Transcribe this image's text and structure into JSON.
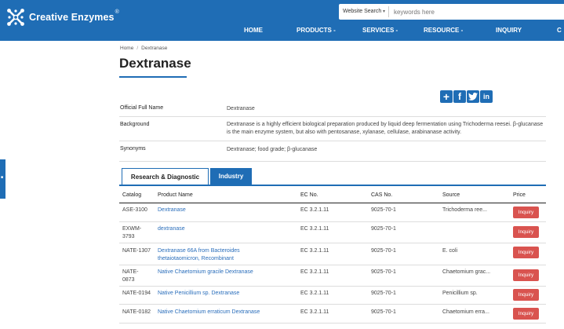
{
  "header": {
    "brand": "Creative Enzymes",
    "brand_mark": "®",
    "search_scope": "Website Search",
    "search_placeholder": "keywords here",
    "nav": [
      {
        "label": "HOME"
      },
      {
        "label": "PRODUCTS -"
      },
      {
        "label": "SERVICES -"
      },
      {
        "label": "RESOURCE -"
      },
      {
        "label": "INQUIRY"
      },
      {
        "label": "C"
      }
    ]
  },
  "breadcrumb": {
    "home": "Home",
    "sep": "/",
    "current": "Dextranase"
  },
  "page_title": "Dextranase",
  "share_icons": [
    "plus-icon",
    "facebook-icon",
    "twitter-icon",
    "linkedin-icon"
  ],
  "share_glyphs": [
    "+",
    "f",
    "t",
    "in"
  ],
  "info": [
    {
      "label": "Official Full Name",
      "value": "Dextranase"
    },
    {
      "label": "Background",
      "value": "Dextranase is a highly efficient biological preparation produced by liquid deep fermentation using Trichoderma reesei. β-glucanase is the main enzyme system, but also with pentosanase, xylanase, cellulase, arabinanase activity."
    },
    {
      "label": "Synonyms",
      "value": "Dextranase; food grade; β-glucanase"
    }
  ],
  "tabs": {
    "active": "Research & Diagnostic",
    "inactive": "Industry"
  },
  "table": {
    "headers": [
      "Catalog",
      "Product Name",
      "EC No.",
      "CAS No.",
      "Source",
      "Price"
    ],
    "inquiry_label": "Inquiry",
    "rows": [
      {
        "catalog": "ASE-3100",
        "name": "Dextranase",
        "ec": "EC 3.2.1.11",
        "cas": "9025-70-1",
        "source": "Trichoderma ree..."
      },
      {
        "catalog": "EXWM-3793",
        "name": "dextranase",
        "ec": "EC 3.2.1.11",
        "cas": "9025-70-1",
        "source": ""
      },
      {
        "catalog": "NATE-1307",
        "name": "Dextranase 66A from Bacteroides thetaiotaomicron, Recombinant",
        "ec": "EC 3.2.1.11",
        "cas": "9025-70-1",
        "source": "E. coli"
      },
      {
        "catalog": "NATE-0873",
        "name": "Native Chaetomium gracile Dextranase",
        "ec": "EC 3.2.1.11",
        "cas": "9025-70-1",
        "source": "Chaetomium grac..."
      },
      {
        "catalog": "NATE-0194",
        "name": "Native Penicillium sp. Dextranase",
        "ec": "EC 3.2.1.11",
        "cas": "9025-70-1",
        "source": "Penicillium sp."
      },
      {
        "catalog": "NATE-0182",
        "name": "Native Chaetomium erraticum Dextranase",
        "ec": "EC 3.2.1.11",
        "cas": "9025-70-1",
        "source": "Chaetomium erra..."
      }
    ]
  },
  "colors": {
    "brand_blue": "#1f6db5",
    "inquiry_red": "#d9534f",
    "link_blue": "#2a6ebb"
  }
}
